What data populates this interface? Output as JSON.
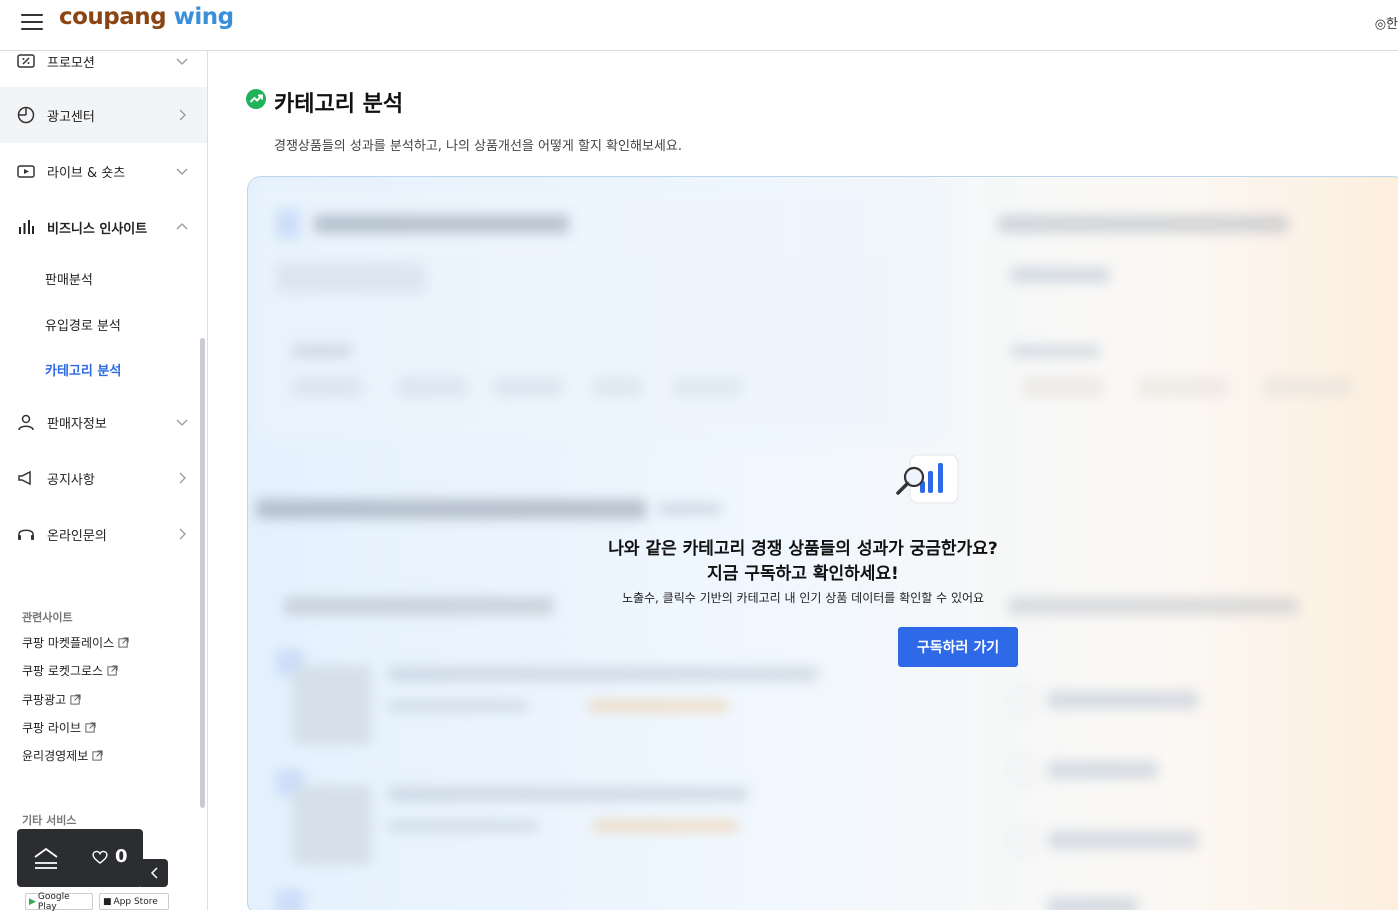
{
  "header": {
    "logo_part1": "coupang",
    "logo_part2": " wing",
    "language": "한"
  },
  "sidebar": {
    "items": [
      {
        "label": "프로모션"
      },
      {
        "label": "광고센터"
      },
      {
        "label": "라이브 & 숏츠"
      },
      {
        "label": "비즈니스 인사이트"
      },
      {
        "label": "판매자정보"
      },
      {
        "label": "공지사항"
      },
      {
        "label": "온라인문의"
      }
    ],
    "sub_items": [
      {
        "label": "판매분석"
      },
      {
        "label": "유입경로 분석"
      },
      {
        "label": "카테고리 분석"
      }
    ],
    "related_title": "관련사이트",
    "related_links": [
      {
        "label": "쿠팡 마켓플레이스"
      },
      {
        "label": "쿠팡 로켓그로스"
      },
      {
        "label": "쿠팡광고"
      },
      {
        "label": "쿠팡 라이브"
      },
      {
        "label": "윤리경영제보"
      }
    ],
    "other_title": "기타 서비스",
    "store_google": "Google Play",
    "store_apple": "App Store"
  },
  "floating": {
    "like_count": "0"
  },
  "main": {
    "title": "카테고리 분석",
    "description": "경쟁상품들의 성과를 분석하고, 나의 상품개선을 어떻게 할지 확인해보세요.",
    "overlay": {
      "question_line1": "나와 같은 카테고리 경쟁 상품들의 성과가 궁금한가요?",
      "question_line2": "지금 구독하고 확인하세요!",
      "subtext": "노출수, 클릭수 기반의 카테고리 내 인기 상품 데이터를 확인할 수 있어요",
      "button_label": "구독하러 가기"
    }
  },
  "colors": {
    "accent": "#2e6ae8",
    "active_nav": "#2d6ae3",
    "success_green": "#1fb25a"
  }
}
